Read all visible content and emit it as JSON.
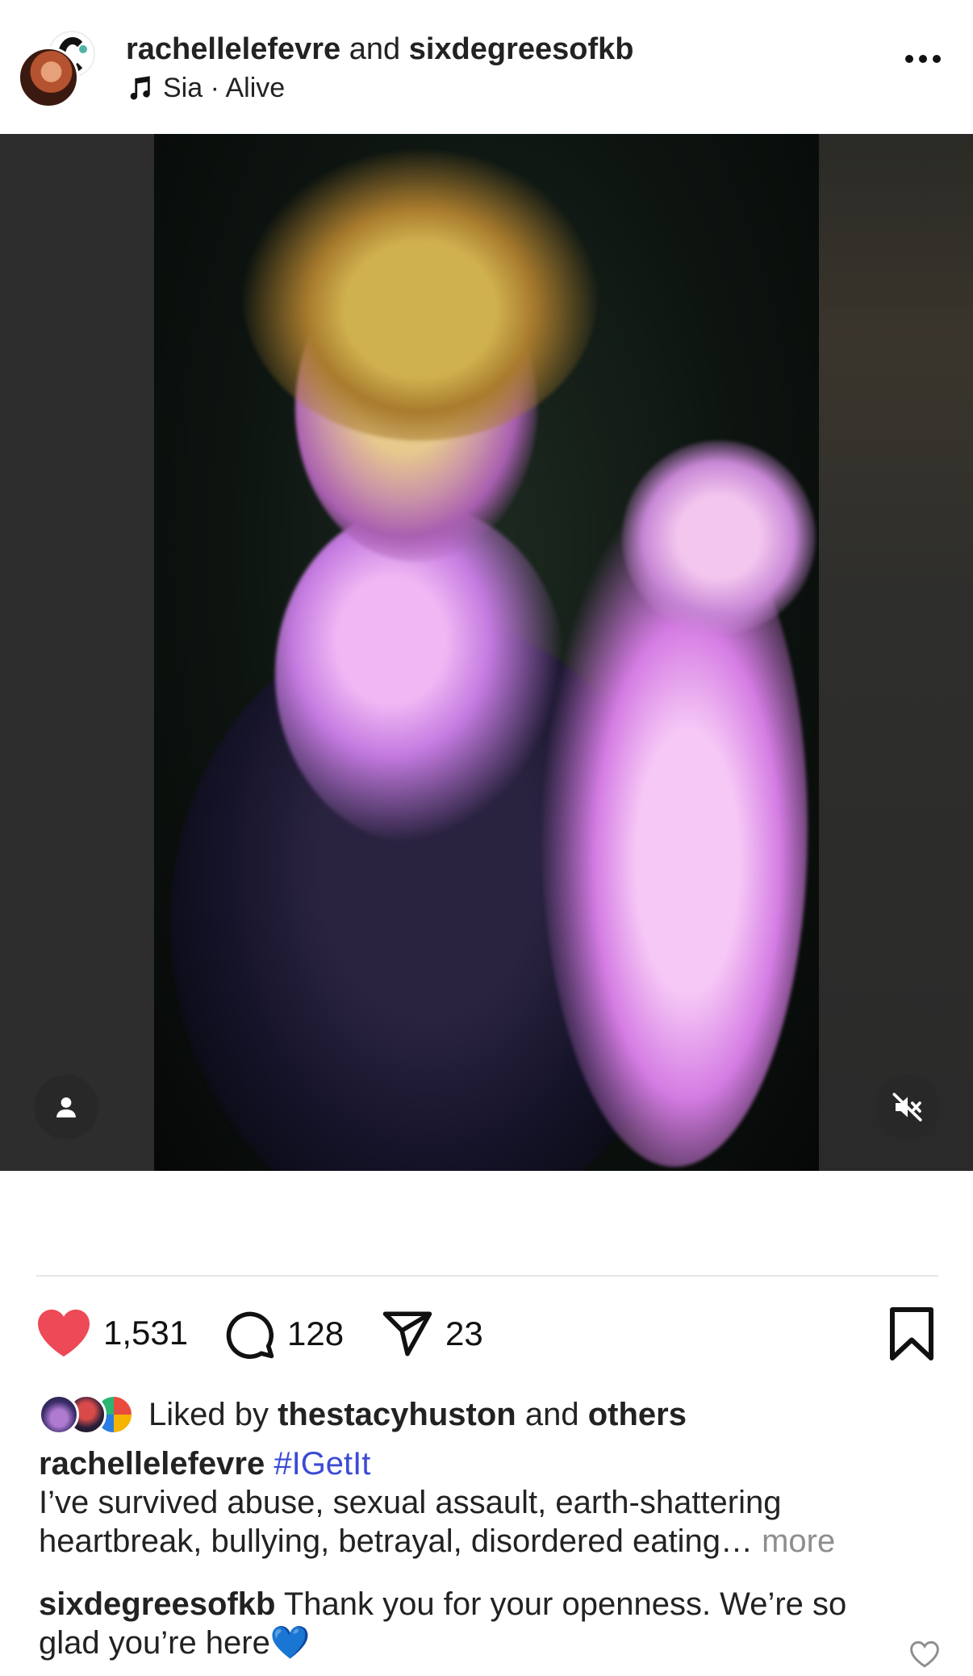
{
  "header": {
    "user1": "rachellelefevre",
    "and_word": "and",
    "user2": "sixdegreesofkb",
    "music": "Sia · Alive"
  },
  "media": {
    "user_tag_icon": "user-icon",
    "mute_icon": "speaker-muted-icon"
  },
  "actions": {
    "likes": "1,531",
    "comments": "128",
    "shares": "23",
    "like_color": "#ed4956"
  },
  "liked_by": {
    "prefix": "Liked by",
    "user": "thestacyhuston",
    "and_word": "and",
    "others": "others"
  },
  "caption": {
    "user": "rachellelefevre",
    "hashtag": "#IGetIt",
    "text": "I’ve survived abuse, sexual assault, earth-shattering heartbreak, bullying, betrayal, disordered eating…",
    "more": "more"
  },
  "comment": {
    "user": "sixdegreesofkb",
    "text": "Thank you for your openness. We’re so glad you’re here💙"
  },
  "colors": {
    "hashtag": "#3b4bd4",
    "muted_text": "#8e8e8e"
  }
}
